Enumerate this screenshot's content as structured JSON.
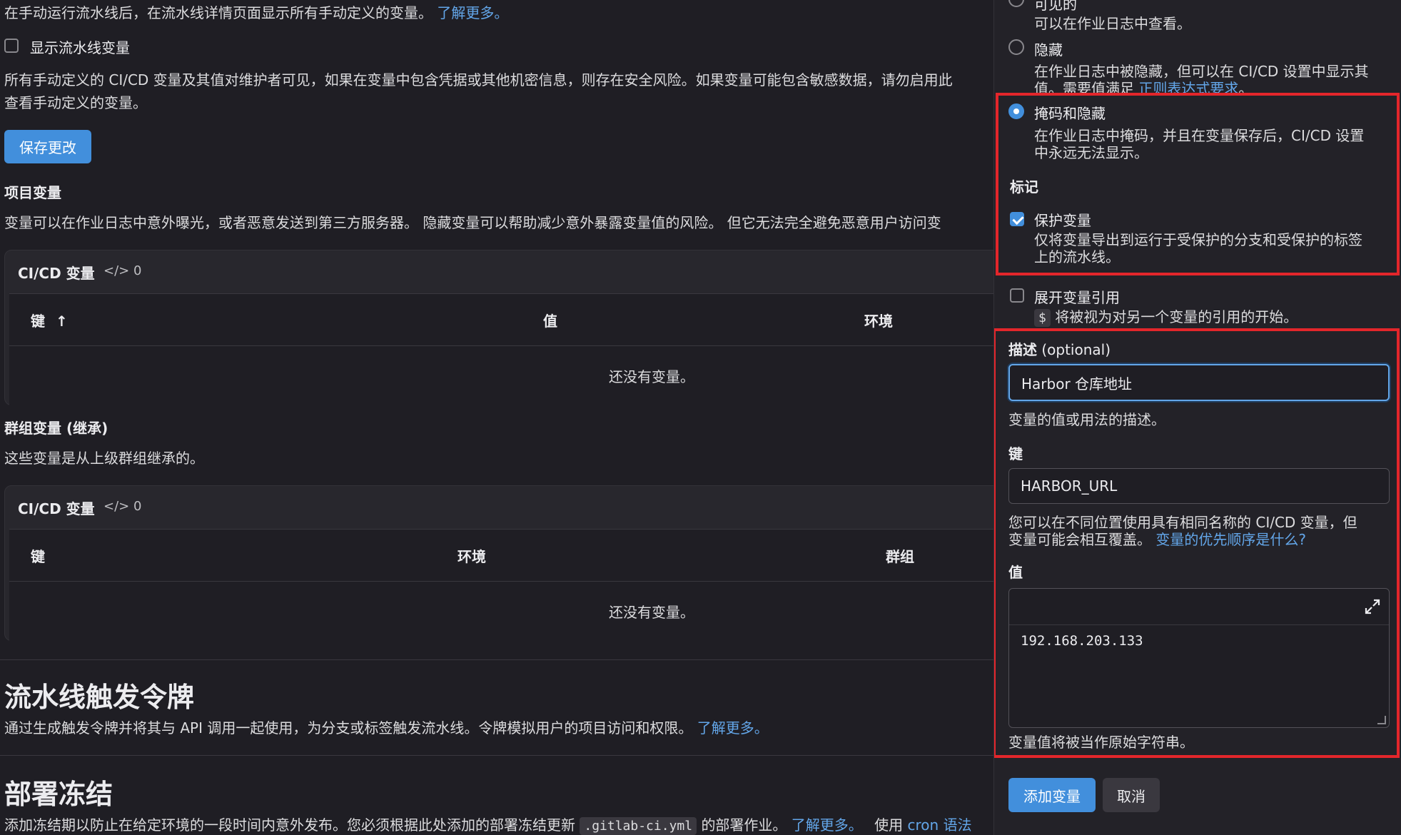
{
  "main": {
    "pipeline_vars_info": "在手动运行流水线后，在流水线详情页面显示所有手动定义的变量。",
    "learn_more": "了解更多。",
    "show_pipeline_vars_label": "显示流水线变量",
    "security_warning_line1": "所有手动定义的 CI/CD 变量及其值对维护者可见，如果在变量中包含凭据或其他机密信息，则存在安全风险。如果变量可能包含敏感数据，请勿启用此",
    "security_warning_line2": "查看手动定义的变量。",
    "save_button": "保存更改",
    "project_vars_title": "项目变量",
    "project_vars_desc": "变量可以在作业日志中意外曝光，或者恶意发送到第三方服务器。 隐藏变量可以帮助减少意外暴露变量值的风险。 但它无法完全避免恶意用户访问变",
    "project_card": {
      "title": "CI/CD 变量",
      "count": "0",
      "columns": [
        "键",
        "值",
        "环境"
      ],
      "empty": "还没有变量。"
    },
    "group_vars_title": "群组变量 (继承)",
    "group_vars_desc": "这些变量是从上级群组继承的。",
    "group_card": {
      "title": "CI/CD 变量",
      "count": "0",
      "columns": [
        "键",
        "环境",
        "群组"
      ],
      "empty": "还没有变量。"
    },
    "trigger_tokens_title": "流水线触发令牌",
    "trigger_tokens_desc": "通过生成触发令牌并将其与 API 调用一起使用，为分支或标签触发流水线。令牌模拟用户的项目访问和权限。",
    "trigger_learn_more": "了解更多。",
    "deploy_freeze_title": "部署冻结",
    "deploy_freeze_desc1": "添加冻结期以防止在给定环境的一段时间内意外发布。您必须根据此处添加的部署冻结更新",
    "deploy_freeze_code": ".gitlab-ci.yml",
    "deploy_freeze_desc2": "的部署作业。",
    "deploy_learn_more": "了解更多。",
    "deploy_use": "使用",
    "deploy_cron": "cron 语法"
  },
  "drawer": {
    "visibility": {
      "visible_label": "可见的",
      "visible_desc": "可以在作业日志中查看。",
      "masked_label": "隐藏",
      "masked_desc_line1": "在作业日志中被隐藏，但可以在 CI/CD 设置中显示其",
      "masked_desc_line2": "值。需要值满足",
      "masked_desc_link": "正则表达式要求",
      "masked_desc_end": "。",
      "mask_hide_label": "掩码和隐藏",
      "mask_hide_desc_line1": "在作业日志中掩码，并且在变量保存后，CI/CD 设置",
      "mask_hide_desc_line2": "中永远无法显示。"
    },
    "flags_title": "标记",
    "protect_label": "保护变量",
    "protect_desc_line1": "仅将变量导出到运行于受保护的分支和受保护的标签",
    "protect_desc_line2": "上的流水线。",
    "expand_label": "展开变量引用",
    "expand_code": "$",
    "expand_desc": "将被视为对另一个变量的引用的开始。",
    "description_label": "描述",
    "description_optional": "(optional)",
    "description_value": "Harbor 仓库地址",
    "description_help": "变量的值或用法的描述。",
    "key_label": "键",
    "key_value": "HARBOR_URL",
    "key_help_line1": "您可以在不同位置使用具有相同名称的 CI/CD 变量，但",
    "key_help_line2": "变量可能会相互覆盖。",
    "key_help_link": "变量的优先顺序是什么?",
    "value_label": "值",
    "value_value": "192.168.203.133",
    "value_help": "变量值将被当作原始字符串。",
    "add_button": "添加变量",
    "cancel_button": "取消"
  },
  "colors": {
    "accent": "#428fdc",
    "link": "#63a6e9",
    "highlight_border": "#e3262b",
    "background": "#1f1e24"
  }
}
